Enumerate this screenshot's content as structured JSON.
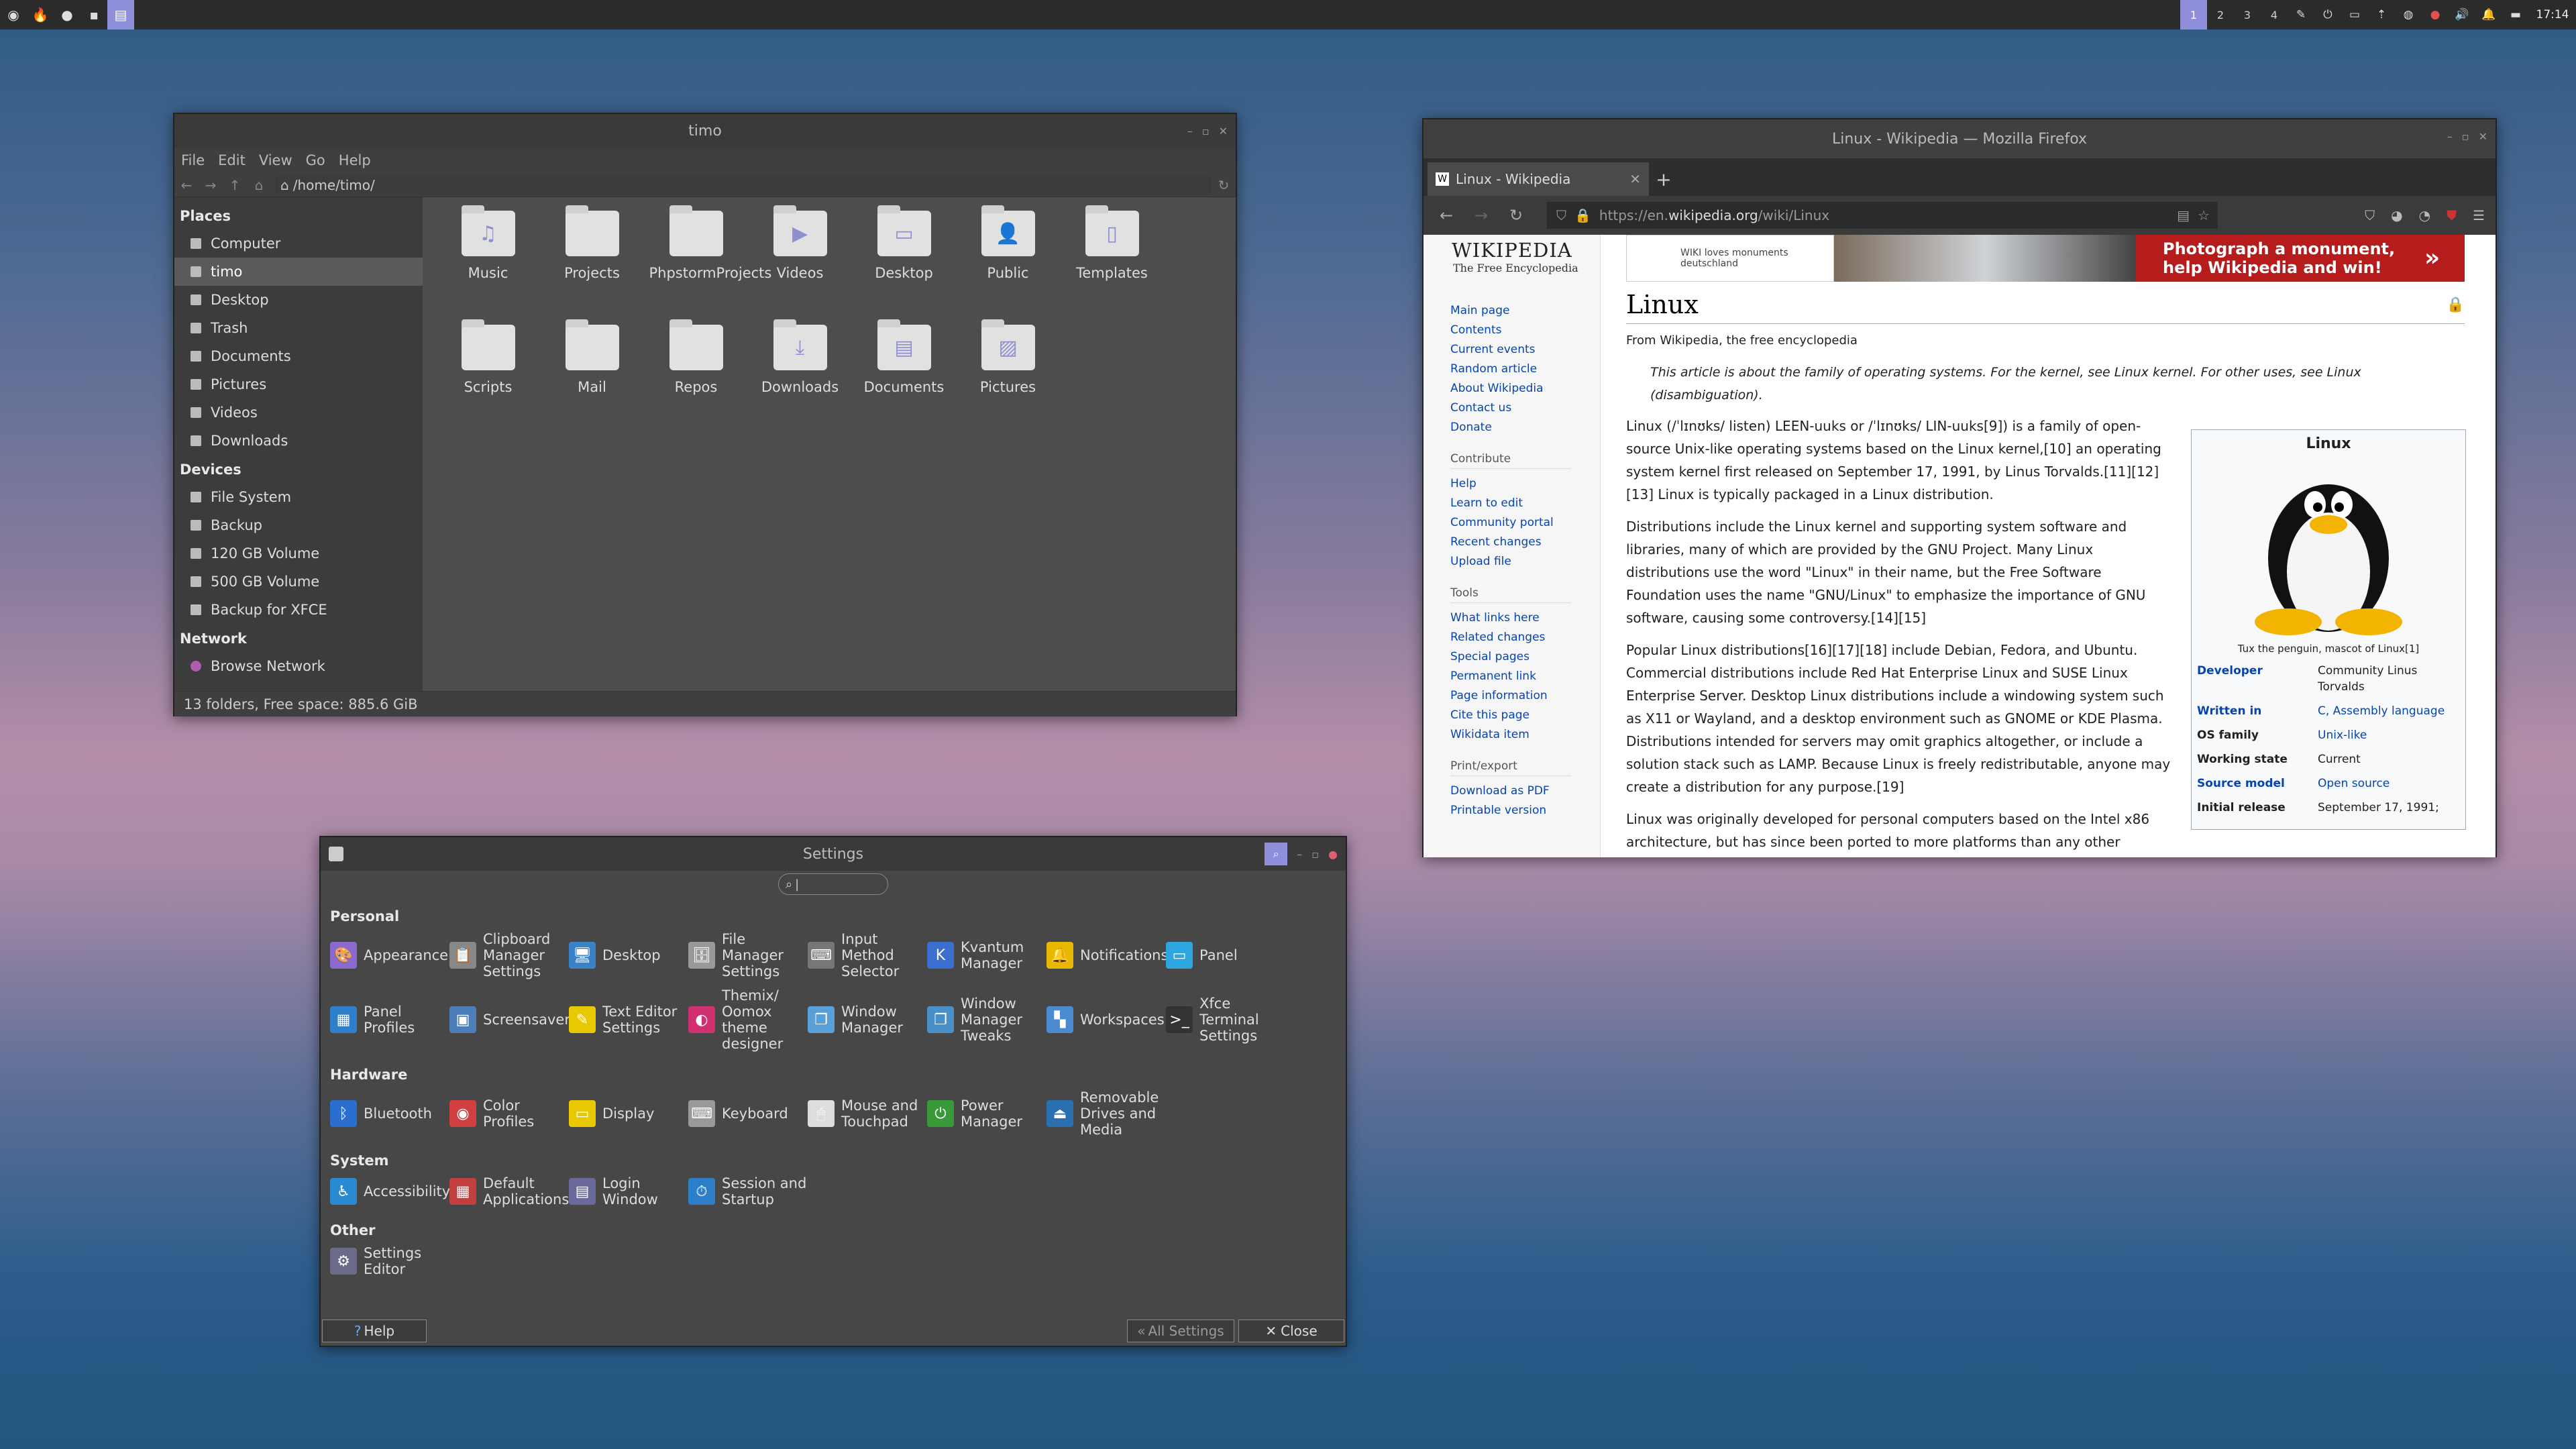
{
  "panel": {
    "clock": "17:14",
    "workspaces": [
      "1",
      "2",
      "3",
      "4"
    ]
  },
  "fm": {
    "title": "timo",
    "menu": [
      "File",
      "Edit",
      "View",
      "Go",
      "Help"
    ],
    "path": "/home/timo/",
    "places_h": "Places",
    "devices_h": "Devices",
    "network_h": "Network",
    "places": [
      "Computer",
      "timo",
      "Desktop",
      "Trash",
      "Documents",
      "Pictures",
      "Videos",
      "Downloads"
    ],
    "devices": [
      "File System",
      "Backup",
      "120 GB Volume",
      "500 GB Volume",
      "Backup for XFCE"
    ],
    "network": [
      "Browse Network"
    ],
    "folders": [
      "Music",
      "Projects",
      "PhpstormProjects",
      "Videos",
      "Desktop",
      "Public",
      "Templates",
      "Scripts",
      "Mail",
      "Repos",
      "Downloads",
      "Documents",
      "Pictures"
    ],
    "status": "13 folders, Free space: 885.6 GiB"
  },
  "ff": {
    "title": "Linux - Wikipedia — Mozilla Firefox",
    "tab": "Linux - Wikipedia",
    "url_pre": "https://en.",
    "url_dom": "wikipedia.org",
    "url_post": "/wiki/Linux",
    "logo": "Wikipedia",
    "tagline": "The Free Encyclopedia",
    "nav": [
      "Main page",
      "Contents",
      "Current events",
      "Random article",
      "About Wikipedia",
      "Contact us",
      "Donate"
    ],
    "contribute_h": "Contribute",
    "contribute": [
      "Help",
      "Learn to edit",
      "Community portal",
      "Recent changes",
      "Upload file"
    ],
    "tools_h": "Tools",
    "tools": [
      "What links here",
      "Related changes",
      "Special pages",
      "Permanent link",
      "Page information",
      "Cite this page",
      "Wikidata item"
    ],
    "print_h": "Print/export",
    "print": [
      "Download as PDF",
      "Printable version"
    ],
    "banner_left": "WIKI loves monuments deutschland",
    "banner_right": "Photograph a monument, help Wikipedia and win!",
    "article_title": "Linux",
    "from": "From Wikipedia, the free encyclopedia",
    "hatnote": "This article is about the family of operating systems. For the kernel, see Linux kernel. For other uses, see Linux (disambiguation).",
    "p1": "Linux (/ˈlɪnʊks/ listen) LEEN-uuks or /ˈlɪnʊks/ LIN-uuks[9]) is a family of open-source Unix-like operating systems based on the Linux kernel,[10] an operating system kernel first released on September 17, 1991, by Linus Torvalds.[11][12][13] Linux is typically packaged in a Linux distribution.",
    "p2": "Distributions include the Linux kernel and supporting system software and libraries, many of which are provided by the GNU Project. Many Linux distributions use the word \"Linux\" in their name, but the Free Software Foundation uses the name \"GNU/Linux\" to emphasize the importance of GNU software, causing some controversy.[14][15]",
    "p3": "Popular Linux distributions[16][17][18] include Debian, Fedora, and Ubuntu. Commercial distributions include Red Hat Enterprise Linux and SUSE Linux Enterprise Server. Desktop Linux distributions include a windowing system such as X11 or Wayland, and a desktop environment such as GNOME or KDE Plasma. Distributions intended for servers may omit graphics altogether, or include a solution stack such as LAMP. Because Linux is freely redistributable, anyone may create a distribution for any purpose.[19]",
    "p4": "Linux was originally developed for personal computers based on the Intel x86 architecture, but has since been ported to more platforms than any other",
    "ib_title": "Linux",
    "ib_caption": "Tux the penguin, mascot of Linux[1]",
    "ib_rows": [
      {
        "k": "Developer",
        "v": "Community Linus Torvalds"
      },
      {
        "k": "Written in",
        "v": "C, Assembly language"
      },
      {
        "k": "OS family",
        "v": "Unix-like"
      },
      {
        "k": "Working state",
        "v": "Current"
      },
      {
        "k": "Source model",
        "v": "Open source"
      },
      {
        "k": "Initial release",
        "v": "September 17, 1991;"
      }
    ]
  },
  "st": {
    "title": "Settings",
    "personal_h": "Personal",
    "hardware_h": "Hardware",
    "system_h": "System",
    "other_h": "Other",
    "personal": [
      {
        "l": "Appearance",
        "ic": "🎨",
        "c": "#8b6ad0"
      },
      {
        "l": "Clipboard Manager Settings",
        "ic": "📋",
        "c": "#888"
      },
      {
        "l": "Desktop",
        "ic": "🖥",
        "c": "#3a82c8"
      },
      {
        "l": "File Manager Settings",
        "ic": "🗄",
        "c": "#999"
      },
      {
        "l": "Input Method Selector",
        "ic": "⌨",
        "c": "#777"
      },
      {
        "l": "Kvantum Manager",
        "ic": "K",
        "c": "#3a6fd0"
      },
      {
        "l": "Notifications",
        "ic": "🔔",
        "c": "#e8b800"
      },
      {
        "l": "Panel",
        "ic": "▭",
        "c": "#2ea7e0"
      },
      {
        "l": "Panel Profiles",
        "ic": "▦",
        "c": "#2c7fc8"
      },
      {
        "l": "Screensaver",
        "ic": "▣",
        "c": "#4a7fb8"
      },
      {
        "l": "Text Editor Settings",
        "ic": "✎",
        "c": "#e8c800"
      },
      {
        "l": "Themix/ Oomox theme designer",
        "ic": "◐",
        "c": "#d03070"
      },
      {
        "l": "Window Manager",
        "ic": "❐",
        "c": "#5aa0d8"
      },
      {
        "l": "Window Manager Tweaks",
        "ic": "❐",
        "c": "#4a90c8"
      },
      {
        "l": "Workspaces",
        "ic": "▚",
        "c": "#4a8ad0"
      },
      {
        "l": "Xfce Terminal Settings",
        "ic": ">_",
        "c": "#333"
      }
    ],
    "hardware": [
      {
        "l": "Bluetooth",
        "ic": "ᛒ",
        "c": "#2a6fd0"
      },
      {
        "l": "Color Profiles",
        "ic": "◉",
        "c": "#d04040"
      },
      {
        "l": "Display",
        "ic": "▭",
        "c": "#e8c800"
      },
      {
        "l": "Keyboard",
        "ic": "⌨",
        "c": "#999"
      },
      {
        "l": "Mouse and Touchpad",
        "ic": "🖱",
        "c": "#ddd"
      },
      {
        "l": "Power Manager",
        "ic": "⏻",
        "c": "#3a9a3a"
      },
      {
        "l": "Removable Drives and Media",
        "ic": "⏏",
        "c": "#2a6fb0"
      }
    ],
    "system": [
      {
        "l": "Accessibility",
        "ic": "♿",
        "c": "#2a8ad0"
      },
      {
        "l": "Default Applications",
        "ic": "▦",
        "c": "#c04040"
      },
      {
        "l": "Login Window",
        "ic": "▤",
        "c": "#6a6a9a"
      },
      {
        "l": "Session and Startup",
        "ic": "⏱",
        "c": "#2a7fc8"
      }
    ],
    "other": [
      {
        "l": "Settings Editor",
        "ic": "⚙",
        "c": "#6a6a8a"
      }
    ],
    "help": "Help",
    "all": "All Settings",
    "close": "Close"
  }
}
